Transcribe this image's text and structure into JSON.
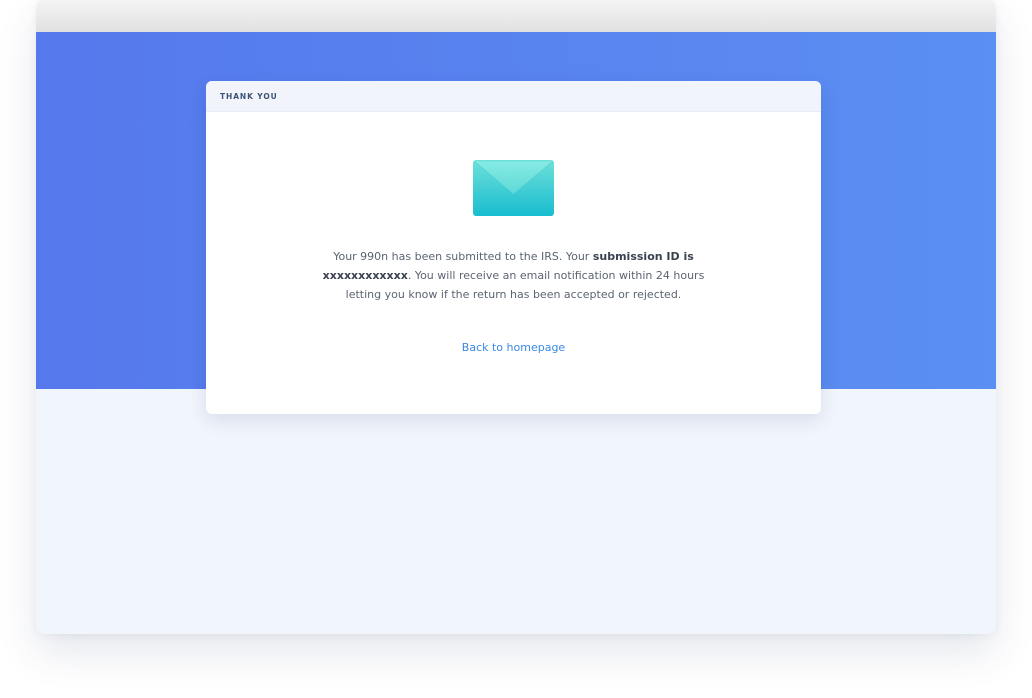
{
  "card": {
    "header_label": "THANK YOU",
    "message": {
      "part1": "Your 990n has been submitted to the IRS. Your ",
      "bold": "submission ID is xxxxxxxxxxxx",
      "part2": ". You will receive an email notification within 24 hours letting you know if the return has been accepted or rejected."
    },
    "back_link": "Back to homepage"
  },
  "icons": {
    "envelope": "envelope-icon"
  },
  "colors": {
    "hero_gradient_start": "#5578ec",
    "hero_gradient_end": "#5b8ff2",
    "page_background": "#f1f5fc",
    "link": "#3b88e4",
    "envelope_top": "#7ee6df",
    "envelope_bottom": "#1cc0d2"
  }
}
